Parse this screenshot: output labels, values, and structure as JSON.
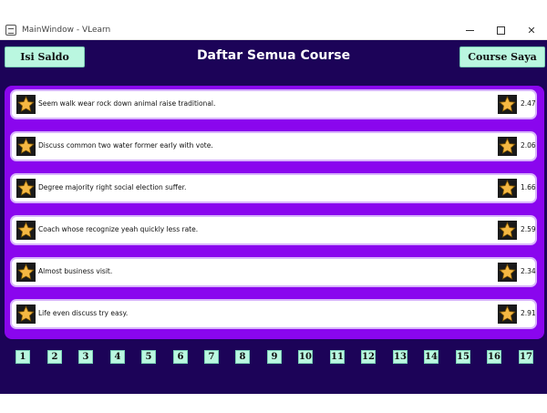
{
  "window": {
    "title": "MainWindow - VLearn",
    "minimize_glyph": "—",
    "close_glyph": "✕"
  },
  "header": {
    "topup_label": "Isi Saldo",
    "title": "Daftar Semua Course",
    "my_courses_label": "Course Saya"
  },
  "courses": [
    {
      "title": "Seem walk wear rock down animal raise traditional.",
      "rating": "2.47"
    },
    {
      "title": "Discuss common two water former early with vote.",
      "rating": "2.06"
    },
    {
      "title": "Degree majority right social election suffer.",
      "rating": "1.66"
    },
    {
      "title": "Coach whose recognize yeah quickly less rate.",
      "rating": "2.59"
    },
    {
      "title": "Almost business visit.",
      "rating": "2.34"
    },
    {
      "title": "Life even discuss try easy.",
      "rating": "2.91"
    }
  ],
  "pagination": [
    "1",
    "2",
    "3",
    "4",
    "5",
    "6",
    "7",
    "8",
    "9",
    "10",
    "11",
    "12",
    "13",
    "14",
    "15",
    "16",
    "17"
  ],
  "icons": {
    "app": "app-icon",
    "course": "star-icon",
    "rating": "star-icon"
  },
  "colors": {
    "background": "#1c0358",
    "panel": "#8a06ee",
    "button": "#baf7e0",
    "star": "#f5b843"
  }
}
